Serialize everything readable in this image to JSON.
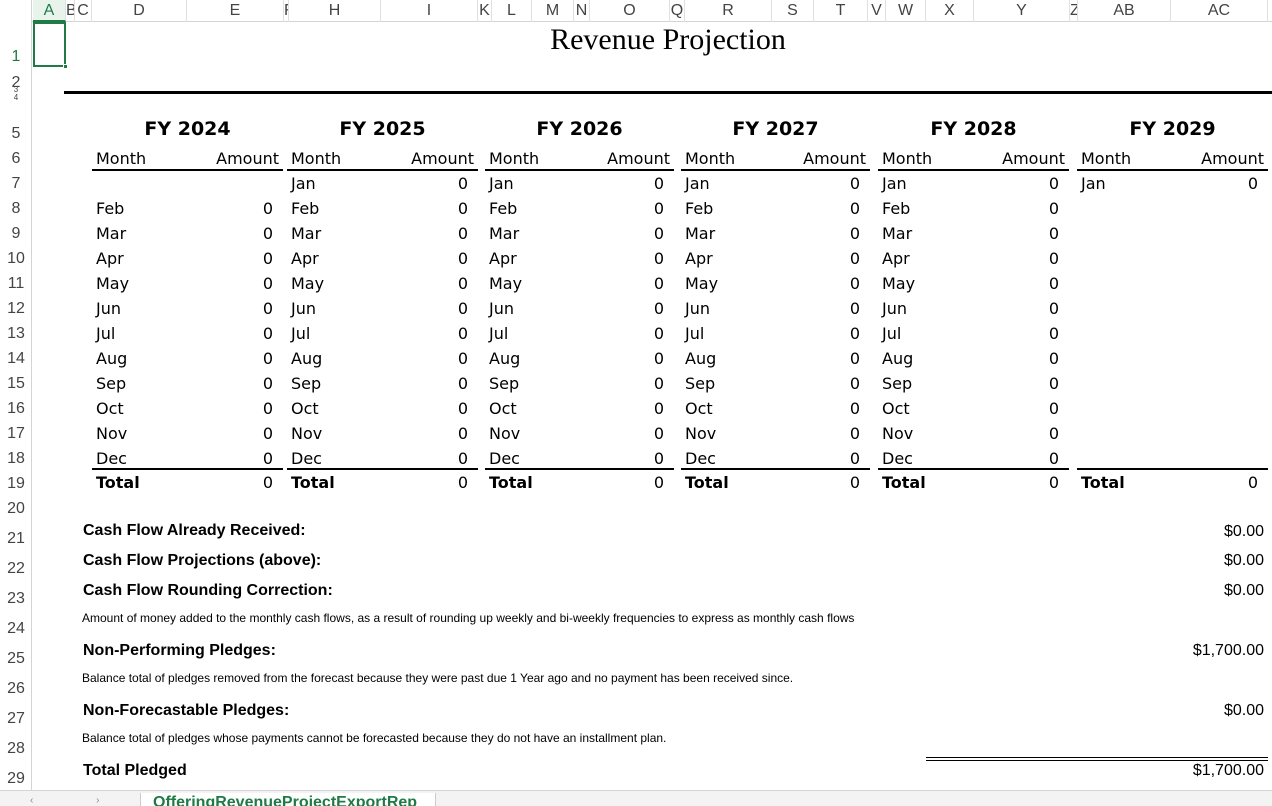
{
  "columns": [
    "A",
    "B",
    "C",
    "D",
    "E",
    "F",
    "H",
    "I",
    "K",
    "L",
    "M",
    "N",
    "O",
    "Q",
    "R",
    "S",
    "T",
    "V",
    "W",
    "X",
    "Y",
    "Z",
    "AB",
    "AC"
  ],
  "rows": [
    "1",
    "2",
    "3",
    "4",
    "5",
    "6",
    "7",
    "8",
    "9",
    "10",
    "11",
    "12",
    "13",
    "14",
    "15",
    "16",
    "17",
    "18",
    "19",
    "20",
    "21",
    "22",
    "23",
    "24",
    "25",
    "26",
    "27",
    "28",
    "29"
  ],
  "title": "Revenue Projection",
  "headers": {
    "month": "Month",
    "amount": "Amount",
    "total": "Total"
  },
  "fiscal_years": [
    {
      "label": "FY 2024",
      "rows": [
        [
          "",
          ""
        ],
        [
          "Feb",
          "0"
        ],
        [
          "Mar",
          "0"
        ],
        [
          "Apr",
          "0"
        ],
        [
          "May",
          "0"
        ],
        [
          "Jun",
          "0"
        ],
        [
          "Jul",
          "0"
        ],
        [
          "Aug",
          "0"
        ],
        [
          "Sep",
          "0"
        ],
        [
          "Oct",
          "0"
        ],
        [
          "Nov",
          "0"
        ],
        [
          "Dec",
          "0"
        ]
      ],
      "total": "0"
    },
    {
      "label": "FY 2025",
      "rows": [
        [
          "Jan",
          "0"
        ],
        [
          "Feb",
          "0"
        ],
        [
          "Mar",
          "0"
        ],
        [
          "Apr",
          "0"
        ],
        [
          "May",
          "0"
        ],
        [
          "Jun",
          "0"
        ],
        [
          "Jul",
          "0"
        ],
        [
          "Aug",
          "0"
        ],
        [
          "Sep",
          "0"
        ],
        [
          "Oct",
          "0"
        ],
        [
          "Nov",
          "0"
        ],
        [
          "Dec",
          "0"
        ]
      ],
      "total": "0"
    },
    {
      "label": "FY 2026",
      "rows": [
        [
          "Jan",
          "0"
        ],
        [
          "Feb",
          "0"
        ],
        [
          "Mar",
          "0"
        ],
        [
          "Apr",
          "0"
        ],
        [
          "May",
          "0"
        ],
        [
          "Jun",
          "0"
        ],
        [
          "Jul",
          "0"
        ],
        [
          "Aug",
          "0"
        ],
        [
          "Sep",
          "0"
        ],
        [
          "Oct",
          "0"
        ],
        [
          "Nov",
          "0"
        ],
        [
          "Dec",
          "0"
        ]
      ],
      "total": "0"
    },
    {
      "label": "FY 2027",
      "rows": [
        [
          "Jan",
          "0"
        ],
        [
          "Feb",
          "0"
        ],
        [
          "Mar",
          "0"
        ],
        [
          "Apr",
          "0"
        ],
        [
          "May",
          "0"
        ],
        [
          "Jun",
          "0"
        ],
        [
          "Jul",
          "0"
        ],
        [
          "Aug",
          "0"
        ],
        [
          "Sep",
          "0"
        ],
        [
          "Oct",
          "0"
        ],
        [
          "Nov",
          "0"
        ],
        [
          "Dec",
          "0"
        ]
      ],
      "total": "0"
    },
    {
      "label": "FY 2028",
      "rows": [
        [
          "Jan",
          "0"
        ],
        [
          "Feb",
          "0"
        ],
        [
          "Mar",
          "0"
        ],
        [
          "Apr",
          "0"
        ],
        [
          "May",
          "0"
        ],
        [
          "Jun",
          "0"
        ],
        [
          "Jul",
          "0"
        ],
        [
          "Aug",
          "0"
        ],
        [
          "Sep",
          "0"
        ],
        [
          "Oct",
          "0"
        ],
        [
          "Nov",
          "0"
        ],
        [
          "Dec",
          "0"
        ]
      ],
      "total": "0"
    },
    {
      "label": "FY 2029",
      "rows": [
        [
          "Jan",
          "0"
        ]
      ],
      "total": "0"
    }
  ],
  "cash_flow": {
    "received_label": "Cash Flow Already Received:",
    "received_value": "$0.00",
    "projections_label": "Cash Flow Projections (above):",
    "projections_value": "$0.00",
    "rounding_label": "Cash Flow Rounding Correction:",
    "rounding_value": "$0.00",
    "rounding_note": "Amount of money added to the monthly cash flows, as a result of rounding up weekly and bi-weekly frequencies to express as monthly cash flows",
    "nonperforming_label": "Non-Performing Pledges:",
    "nonperforming_value": "$1,700.00",
    "nonperforming_note": "Balance total of pledges removed from the forecast because they were past due 1 Year ago and no payment has been received since.",
    "nonforecastable_label": "Non-Forecastable Pledges:",
    "nonforecastable_value": "$0.00",
    "nonforecastable_note": "Balance total of pledges whose payments cannot be forecasted because they do not have an installment plan.",
    "total_pledged_label": "Total Pledged",
    "total_pledged_value": "$1,700.00"
  },
  "sheet_tab": "OfferingRevenueProjectExportRep"
}
